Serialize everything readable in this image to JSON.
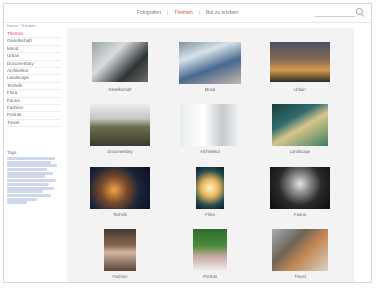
{
  "topnav": {
    "items": [
      {
        "label": "Fotografen",
        "active": false
      },
      {
        "label": "Themen",
        "active": true
      },
      {
        "label": "Bot zu erleben",
        "active": false
      }
    ]
  },
  "sidebar": {
    "breadcrumb": "Home / Themen",
    "categories": [
      {
        "label": "Themen",
        "active": true
      },
      {
        "label": "Gesellschaft",
        "active": false
      },
      {
        "label": "Mood",
        "active": false
      },
      {
        "label": "Urban",
        "active": false
      },
      {
        "label": "Documentary",
        "active": false
      },
      {
        "label": "Architektur",
        "active": false
      },
      {
        "label": "Landscape",
        "active": false
      },
      {
        "label": "Technik",
        "active": false
      },
      {
        "label": "Flora",
        "active": false
      },
      {
        "label": "Fauna",
        "active": false
      },
      {
        "label": "Fashion",
        "active": false
      },
      {
        "label": "Portrait",
        "active": false
      },
      {
        "label": "Travel",
        "active": false
      }
    ],
    "tags_title": "Tags"
  },
  "gallery": [
    {
      "label": "Gesellschaft",
      "thumb": "t-gesellschaft"
    },
    {
      "label": "Mood",
      "thumb": "t-mood"
    },
    {
      "label": "Urban",
      "thumb": "t-urban"
    },
    {
      "label": "Documentary",
      "thumb": "t-documentary"
    },
    {
      "label": "Architektur",
      "thumb": "t-architektur"
    },
    {
      "label": "Landscape",
      "thumb": "t-landscape"
    },
    {
      "label": "Technik",
      "thumb": "t-technik"
    },
    {
      "label": "Flora",
      "thumb": "t-flora"
    },
    {
      "label": "Fauna",
      "thumb": "t-fauna"
    },
    {
      "label": "Fashion",
      "thumb": "t-fashion"
    },
    {
      "label": "Portrait",
      "thumb": "t-portrait"
    },
    {
      "label": "Travel",
      "thumb": "t-travel"
    }
  ],
  "colors": {
    "accent": "#e04545",
    "gallery_bg": "#f3f3f3",
    "link": "#7a8fbf"
  }
}
